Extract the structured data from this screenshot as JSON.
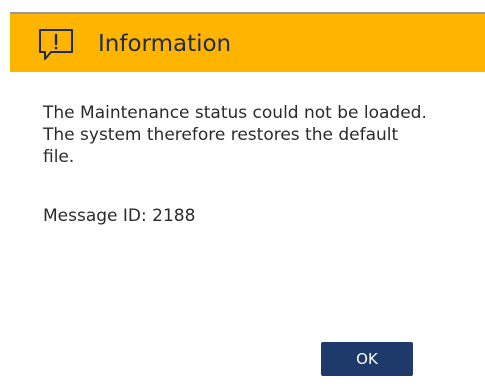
{
  "dialog": {
    "title": "Information",
    "icon": "message-alert-icon",
    "header_color": "#ffb500",
    "message": "The Maintenance status could not be loaded. The system therefore restores the default file.",
    "message_id_label": "Message ID: 2188",
    "ok_label": "OK",
    "button_color": "#1e3a6b"
  }
}
